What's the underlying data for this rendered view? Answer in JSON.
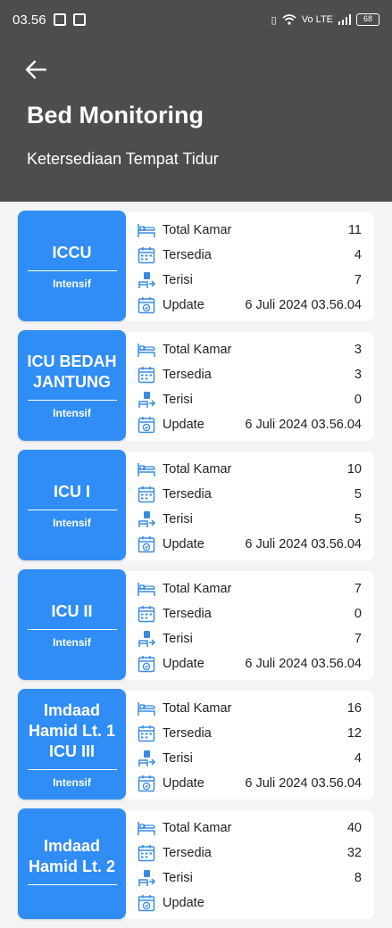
{
  "status_bar": {
    "time": "03.56",
    "battery": "68",
    "network": "Vo LTE"
  },
  "header": {
    "title": "Bed Monitoring",
    "subtitle": "Ketersediaan Tempat Tidur"
  },
  "labels": {
    "total": "Total Kamar",
    "available": "Tersedia",
    "occupied": "Terisi",
    "update": "Update"
  },
  "colors": {
    "header_bg": "#4d4d4d",
    "unit_bg": "#2f8df5",
    "icon": "#3a8be0"
  },
  "icons": {
    "back": "arrow-left-icon",
    "total": "bed-icon",
    "available": "calendar-icon",
    "occupied": "bed-transfer-icon",
    "update": "calendar-check-icon"
  },
  "units": [
    {
      "name": "ICCU",
      "type": "Intensif",
      "total": "11",
      "available": "4",
      "occupied": "7",
      "update": "6 Juli 2024 03.56.04"
    },
    {
      "name": "ICU BEDAH JANTUNG",
      "type": "Intensif",
      "total": "3",
      "available": "3",
      "occupied": "0",
      "update": "6 Juli 2024 03.56.04"
    },
    {
      "name": "ICU I",
      "type": "Intensif",
      "total": "10",
      "available": "5",
      "occupied": "5",
      "update": "6 Juli 2024 03.56.04"
    },
    {
      "name": "ICU II",
      "type": "Intensif",
      "total": "7",
      "available": "0",
      "occupied": "7",
      "update": "6 Juli 2024 03.56.04"
    },
    {
      "name": "Imdaad Hamid Lt. 1 ICU III",
      "type": "Intensif",
      "total": "16",
      "available": "12",
      "occupied": "4",
      "update": "6 Juli 2024 03.56.04"
    },
    {
      "name": "Imdaad Hamid Lt. 2",
      "type": "",
      "total": "40",
      "available": "32",
      "occupied": "8",
      "update": ""
    }
  ]
}
